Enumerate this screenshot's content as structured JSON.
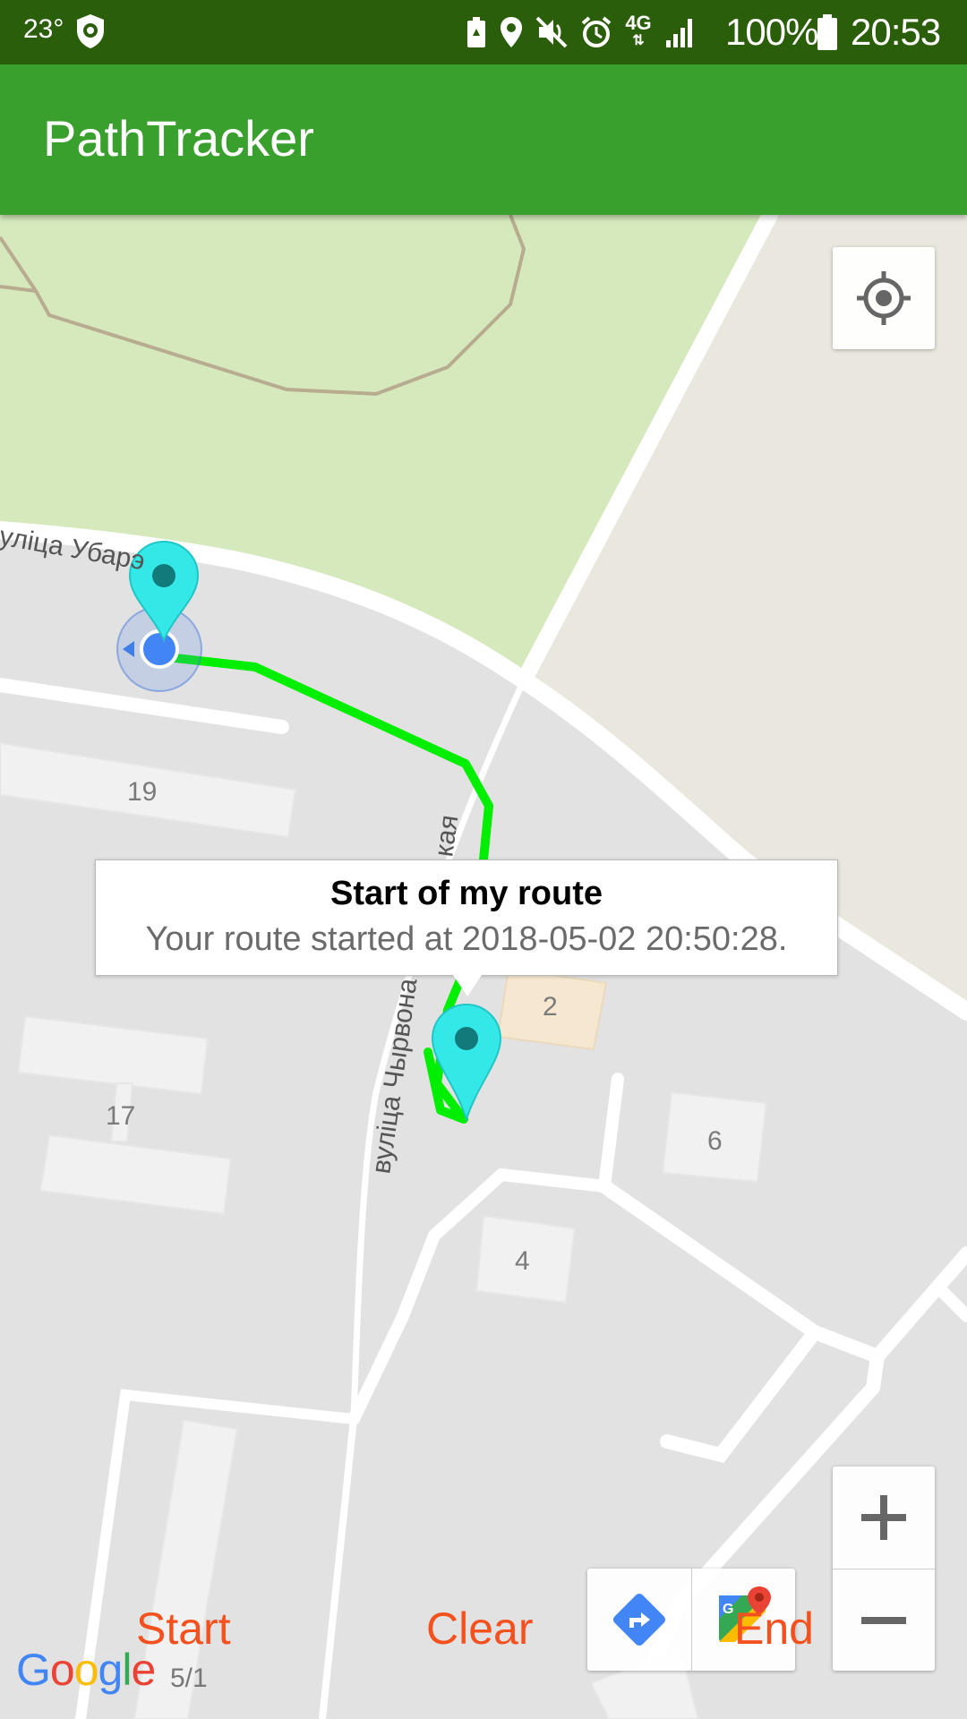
{
  "status_bar": {
    "temperature": "23°",
    "network": "4G",
    "battery_percent": "100%",
    "time": "20:53",
    "icons": [
      "shield-icon",
      "battery-saver-icon",
      "location-icon",
      "mute-icon",
      "alarm-icon",
      "signal-icon",
      "battery-icon"
    ]
  },
  "app_bar": {
    "title": "PathTracker",
    "color": "#3aa02d"
  },
  "map": {
    "street_labels": [
      "вуліца Убарэ",
      "вуліца Чырвонаармейская"
    ],
    "street_label_start": "уліца Убарэ",
    "street_label_vertical": "вуліца Чырвона",
    "street_label_vertical_end": "кая",
    "building_numbers": [
      "19",
      "2",
      "17",
      "6",
      "4"
    ],
    "scale_text": "5/1",
    "route_color": "#00ee00",
    "marker_color": "#35e8e8"
  },
  "info_window": {
    "title": "Start of my route",
    "snippet": "Your route started at 2018-05-02 20:50:28."
  },
  "controls": {
    "start_label": "Start",
    "clear_label": "Clear",
    "end_label": "End",
    "zoom_in_label": "+",
    "zoom_out_label": "−",
    "accent_color": "#f4511e"
  },
  "attribution": {
    "google_letters": [
      "G",
      "o",
      "o",
      "g",
      "l",
      "e"
    ]
  }
}
